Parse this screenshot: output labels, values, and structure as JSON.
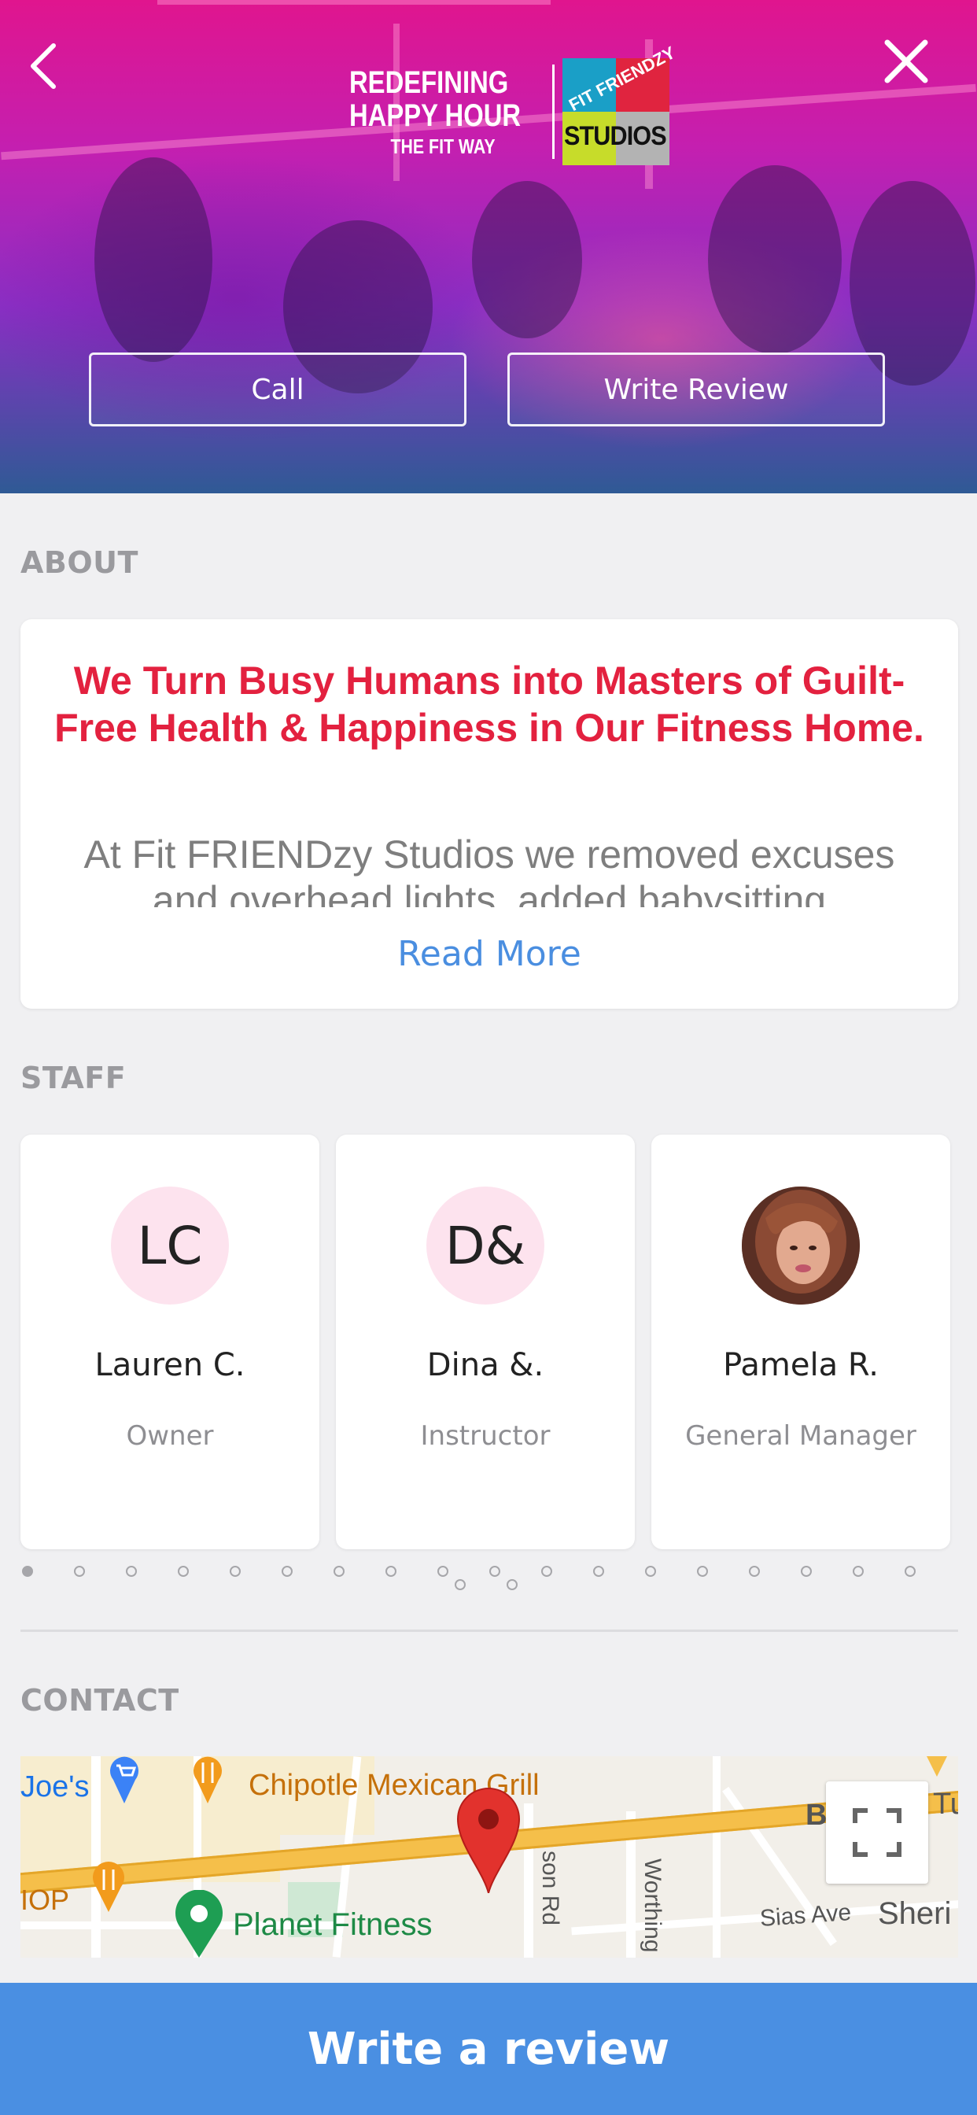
{
  "hero": {
    "logo": {
      "line1": "REDEFINING",
      "line2": "HAPPY HOUR",
      "line3": "THE FIT WAY",
      "badge_top": "FIT FRIENDZY",
      "badge_bottom": "STUDIOS"
    },
    "call_label": "Call",
    "write_review_label": "Write Review",
    "icons": {
      "back": "chevron-left-icon",
      "close": "close-icon"
    }
  },
  "about": {
    "section_title": "ABOUT",
    "headline": "We Turn Busy Humans into Masters of Guilt-Free Health & Happiness in Our Fitness Home.",
    "body": "At Fit FRIENDzy Studios we removed excuses and overhead lights, added babysitting",
    "read_more": "Read More"
  },
  "staff": {
    "section_title": "STAFF",
    "members": [
      {
        "initials": "LC",
        "name": "Lauren C.",
        "role": "Owner"
      },
      {
        "initials": "D&",
        "name": "Dina &.",
        "role": "Instructor"
      },
      {
        "initials": "",
        "name": "Pamela R.",
        "role": "General Manager"
      }
    ],
    "pager_active_index": 0
  },
  "contact": {
    "section_title": "CONTACT",
    "map_labels": {
      "joes": "Joe's",
      "chipotle": "Chipotle Mexican Grill",
      "planet_fitness": "Planet Fitness",
      "hop": "IOP",
      "jackson_rd": "son Rd",
      "worthington": "Worthing",
      "sias_ave": "Sias Ave",
      "sheri": "Sheri",
      "road_b": "B",
      "road_tu": "Tu"
    }
  },
  "colors": {
    "accent_blue": "#4a8fe2",
    "headline_red": "#e3213f",
    "avatar_pink": "#fde3ee"
  },
  "bottom_bar": {
    "label": "Write a review"
  }
}
